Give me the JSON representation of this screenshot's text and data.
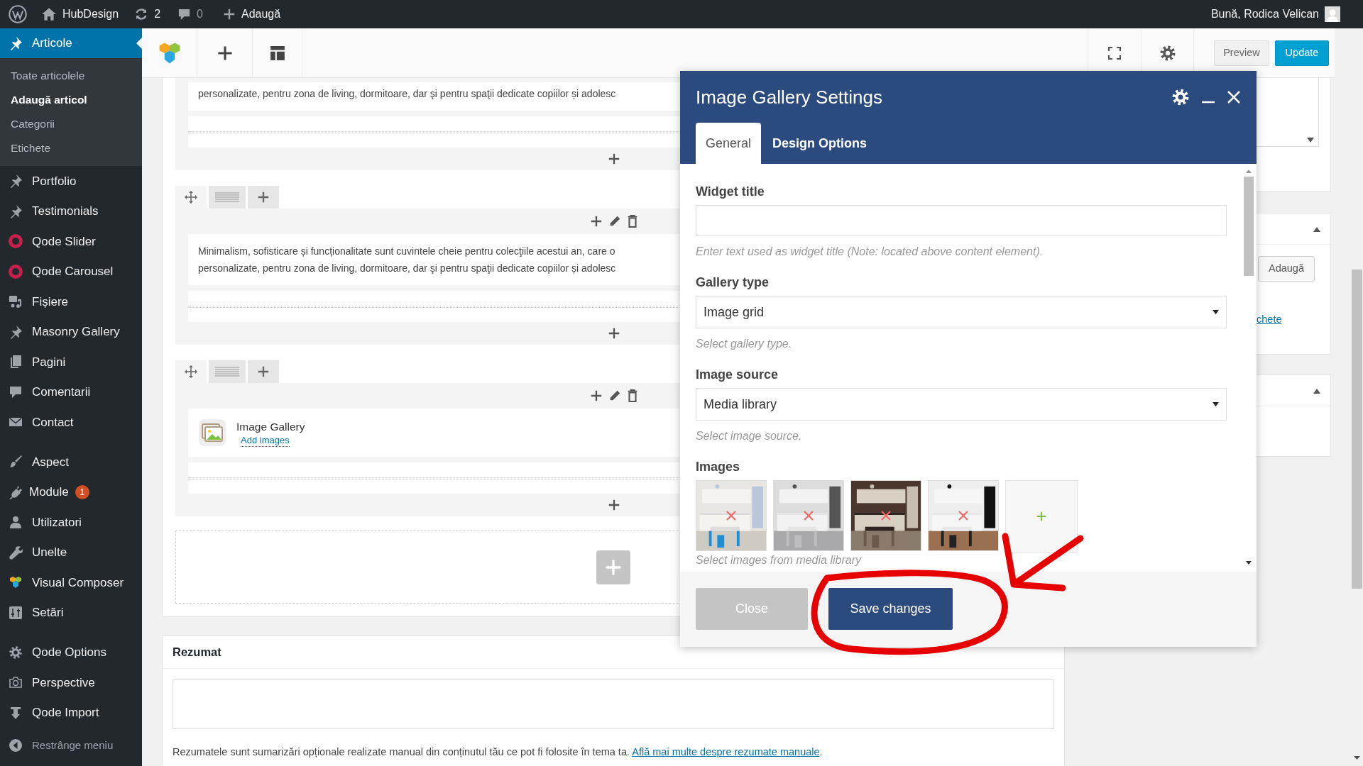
{
  "admin_bar": {
    "site": "HubDesign",
    "updates": "2",
    "comments": "0",
    "new_label": "Adaugă",
    "greeting": "Bună, Rodica Velican"
  },
  "sidebar": {
    "groups": [
      [
        {
          "label": "Articole",
          "selected": true,
          "children": [
            {
              "label": "Toate articolele",
              "selected": false
            },
            {
              "label": "Adaugă articol",
              "selected": true
            },
            {
              "label": "Categorii",
              "selected": false
            },
            {
              "label": "Etichete",
              "selected": false
            }
          ]
        },
        {
          "label": "Portfolio",
          "selected": false
        },
        {
          "label": "Testimonials",
          "selected": false
        },
        {
          "label": "Qode Slider",
          "selected": false
        },
        {
          "label": "Qode Carousel",
          "selected": false
        },
        {
          "label": "Fișiere",
          "selected": false
        },
        {
          "label": "Masonry Gallery",
          "selected": false
        },
        {
          "label": "Pagini",
          "selected": false
        },
        {
          "label": "Comentarii",
          "selected": false
        },
        {
          "label": "Contact",
          "selected": false
        }
      ],
      [
        {
          "label": "Aspect",
          "selected": false
        },
        {
          "label": "Module",
          "selected": false,
          "badge": "1"
        },
        {
          "label": "Utilizatori",
          "selected": false
        },
        {
          "label": "Unelte",
          "selected": false
        },
        {
          "label": "Visual Composer",
          "selected": false
        },
        {
          "label": "Setări",
          "selected": false
        }
      ],
      [
        {
          "label": "Qode Options",
          "selected": false
        },
        {
          "label": "Perspective",
          "selected": false
        },
        {
          "label": "Qode Import",
          "selected": false
        }
      ]
    ],
    "collapse": "Restrânge meniu"
  },
  "toolbar": {
    "buttons": [
      {
        "label": "Preview",
        "kind": "secondary"
      },
      {
        "label": "Update",
        "kind": "primary"
      }
    ]
  },
  "builder": {
    "rows": [
      {
        "kind": "text",
        "lines": [
          "personalizate, pentru zona de living, dormitoare, dar şi pentru spaţii dedicate copiilor și adolesc"
        ]
      },
      {
        "kind": "text",
        "lines": [
          "Minimalism, sofisticare și funcționalitate sunt cuvintele cheie pentru colecţiile acestui an, care o",
          "personalizate, pentru zona de living, dormitoare, dar şi pentru spaţii dedicate copiilor și adolesc"
        ]
      },
      {
        "kind": "gallery",
        "title": "Image Gallery",
        "link": "Add images"
      }
    ]
  },
  "excerpt": {
    "title": "Rezumat",
    "help": "Rezumatele sunt sumarizări opționale realizate manual din conținutul tău ce pot fi folosite în tema ta.",
    "link": "Află mai multe despre rezumate manuale",
    "after": "."
  },
  "side_panel": {
    "tag_button": "Adaugă",
    "tag_link": "chete"
  },
  "modal": {
    "title": "Image Gallery Settings",
    "tabs": [
      {
        "label": "General",
        "selected": true
      },
      {
        "label": "Design Options",
        "selected": false
      }
    ],
    "fields": [
      {
        "kind": "text",
        "label": "Widget title",
        "help": "Enter text used as widget title (Note: located above content element)."
      },
      {
        "kind": "select",
        "label": "Gallery type",
        "value": "Image grid",
        "help": "Select gallery type."
      },
      {
        "kind": "select",
        "label": "Image source",
        "value": "Media library",
        "help": "Select image source."
      },
      {
        "kind": "images",
        "label": "Images",
        "help": "Select images from media library"
      }
    ],
    "buttons": [
      {
        "label": "Close",
        "kind": "secondary"
      },
      {
        "label": "Save changes",
        "kind": "primary"
      }
    ]
  }
}
